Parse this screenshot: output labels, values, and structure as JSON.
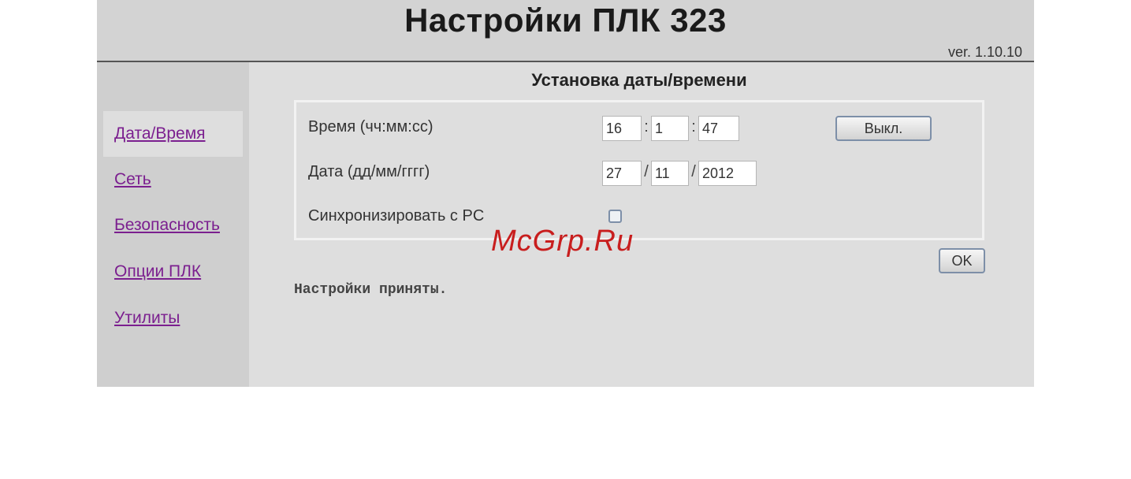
{
  "header": {
    "title": "Настройки ПЛК 323",
    "version": "ver. 1.10.10"
  },
  "sidebar": {
    "items": [
      {
        "label": "Дата/Время",
        "active": true
      },
      {
        "label": "Сеть",
        "active": false
      },
      {
        "label": "Безопасность",
        "active": false
      },
      {
        "label": "Опции ПЛК",
        "active": false
      },
      {
        "label": "Утилиты",
        "active": false
      }
    ]
  },
  "main": {
    "section_title": "Установка даты/времени",
    "time": {
      "label": "Время (чч:мм:сс)",
      "hours": "16",
      "minutes": "1",
      "seconds": "47",
      "separator": ":",
      "toggle_button_label": "Выкл."
    },
    "date": {
      "label": "Дата (дд/мм/гггг)",
      "day": "27",
      "month": "11",
      "year": "2012",
      "separator": "/"
    },
    "sync": {
      "label": "Синхронизировать с PC",
      "checked": false
    },
    "ok_button_label": "OK",
    "status_text": "Настройки приняты."
  },
  "watermark": "McGrp.Ru",
  "colors": {
    "link": "#7b1f8f",
    "watermark": "#c81e1e",
    "background": "#dedede"
  }
}
